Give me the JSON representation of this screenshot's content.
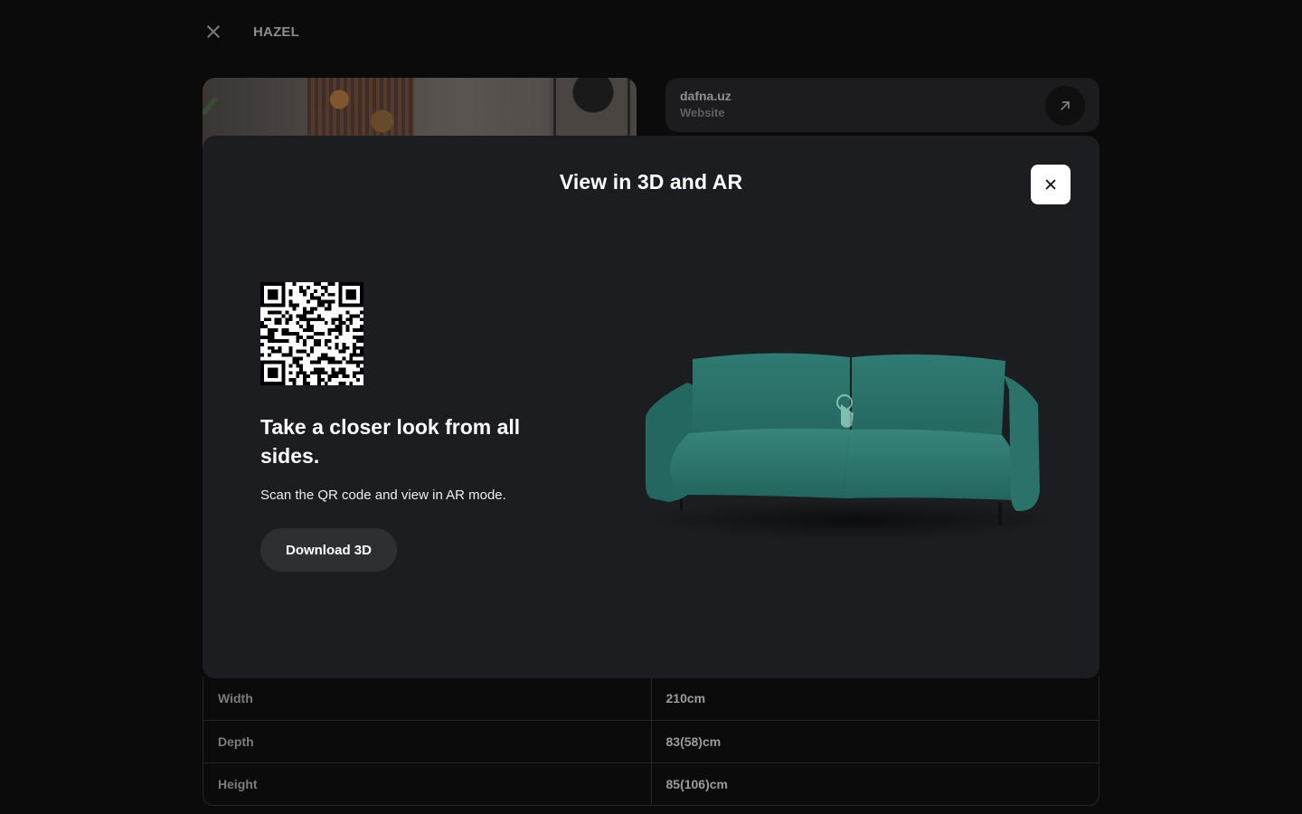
{
  "header": {
    "brand": "HAZEL"
  },
  "website": {
    "domain": "dafna.uz",
    "label": "Website"
  },
  "modal": {
    "title": "View in 3D and AR",
    "headline": "Take a closer look from all sides.",
    "subtext": "Scan the QR code and view in AR mode.",
    "download_label": "Download 3D"
  },
  "specs": [
    {
      "label": "Width",
      "value": "210cm"
    },
    {
      "label": "Depth",
      "value": "83(58)cm"
    },
    {
      "label": "Height",
      "value": "85(106)cm"
    }
  ],
  "colors": {
    "background": "#0b0b0c",
    "modal": "#1c1d20",
    "sofa": "#2f7a72"
  },
  "icons": [
    "close-icon",
    "external-link-icon",
    "qr-code",
    "sofa-3d-model",
    "rotate-hand-icon"
  ]
}
